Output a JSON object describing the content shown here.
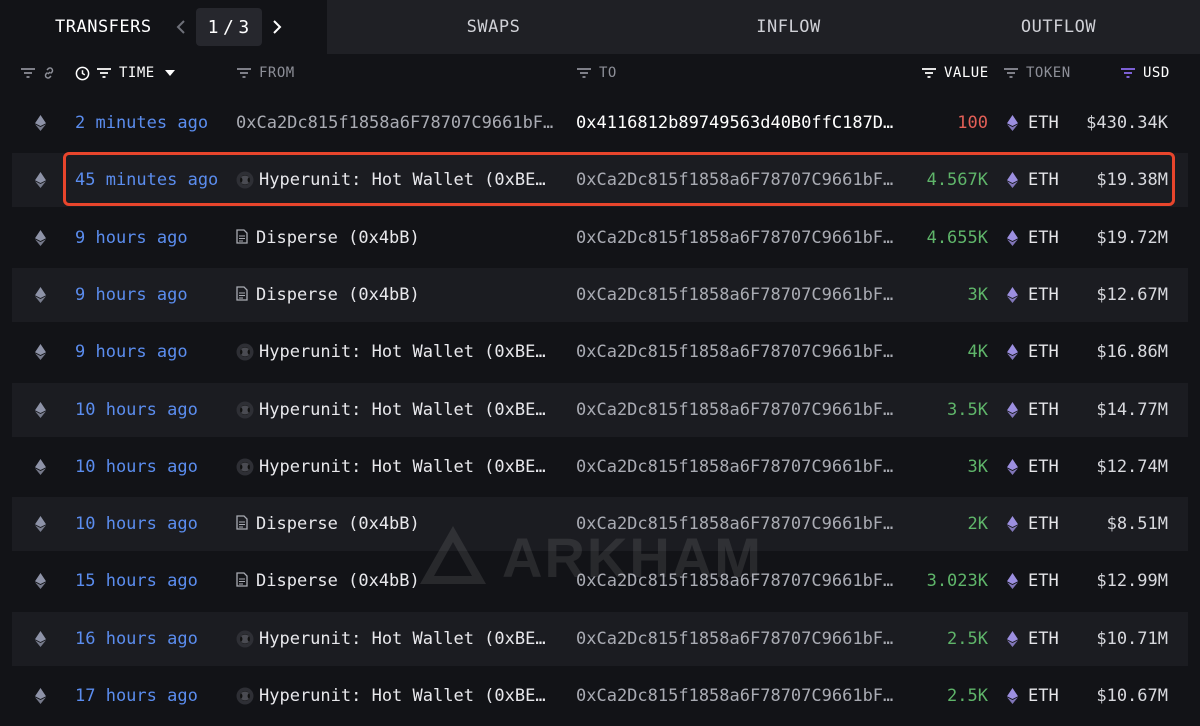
{
  "tabs": [
    {
      "label": "TRANSFERS",
      "active": true
    },
    {
      "label": "SWAPS",
      "active": false
    },
    {
      "label": "INFLOW",
      "active": false
    },
    {
      "label": "OUTFLOW",
      "active": false
    }
  ],
  "pagination": {
    "current": "1",
    "separator": "/",
    "total": "3"
  },
  "columns": {
    "time": "TIME",
    "from": "FROM",
    "to": "TO",
    "value": "VALUE",
    "token": "TOKEN",
    "usd": "USD"
  },
  "colors": {
    "time_link": "#5b8def",
    "value_positive": "#5fb56a",
    "value_negative": "#e25f57",
    "highlight": "#e8452c",
    "usd_filter_accent": "#8b6cf0"
  },
  "watermark": "ARKHAM",
  "rows": [
    {
      "time": "2 minutes ago",
      "from": "0xCa2Dc815f1858a6F78707C9661bF…",
      "from_icon": "none",
      "to": "0x4116812b89749563d40B0ffC187D…",
      "value": "100",
      "token": "ETH",
      "usd": "$430.34K"
    },
    {
      "time": "45 minutes ago",
      "from": "Hyperunit: Hot Wallet (0xBE…",
      "from_icon": "entity-logo-icon",
      "to": "0xCa2Dc815f1858a6F78707C9661bF…",
      "value": "4.567K",
      "token": "ETH",
      "usd": "$19.38M"
    },
    {
      "time": "9 hours ago",
      "from": "Disperse (0x4bB)",
      "from_icon": "contract-icon",
      "to": "0xCa2Dc815f1858a6F78707C9661bF…",
      "value": "4.655K",
      "token": "ETH",
      "usd": "$19.72M"
    },
    {
      "time": "9 hours ago",
      "from": "Disperse (0x4bB)",
      "from_icon": "contract-icon",
      "to": "0xCa2Dc815f1858a6F78707C9661bF…",
      "value": "3K",
      "token": "ETH",
      "usd": "$12.67M"
    },
    {
      "time": "9 hours ago",
      "from": "Hyperunit: Hot Wallet (0xBE…",
      "from_icon": "entity-logo-icon",
      "to": "0xCa2Dc815f1858a6F78707C9661bF…",
      "value": "4K",
      "token": "ETH",
      "usd": "$16.86M"
    },
    {
      "time": "10 hours ago",
      "from": "Hyperunit: Hot Wallet (0xBE…",
      "from_icon": "entity-logo-icon",
      "to": "0xCa2Dc815f1858a6F78707C9661bF…",
      "value": "3.5K",
      "token": "ETH",
      "usd": "$14.77M"
    },
    {
      "time": "10 hours ago",
      "from": "Hyperunit: Hot Wallet (0xBE…",
      "from_icon": "entity-logo-icon",
      "to": "0xCa2Dc815f1858a6F78707C9661bF…",
      "value": "3K",
      "token": "ETH",
      "usd": "$12.74M"
    },
    {
      "time": "10 hours ago",
      "from": "Disperse (0x4bB)",
      "from_icon": "contract-icon",
      "to": "0xCa2Dc815f1858a6F78707C9661bF…",
      "value": "2K",
      "token": "ETH",
      "usd": "$8.51M"
    },
    {
      "time": "15 hours ago",
      "from": "Disperse (0x4bB)",
      "from_icon": "contract-icon",
      "to": "0xCa2Dc815f1858a6F78707C9661bF…",
      "value": "3.023K",
      "token": "ETH",
      "usd": "$12.99M"
    },
    {
      "time": "16 hours ago",
      "from": "Hyperunit: Hot Wallet (0xBE…",
      "from_icon": "entity-logo-icon",
      "to": "0xCa2Dc815f1858a6F78707C9661bF…",
      "value": "2.5K",
      "token": "ETH",
      "usd": "$10.71M"
    },
    {
      "time": "17 hours ago",
      "from": "Hyperunit: Hot Wallet (0xBE…",
      "from_icon": "entity-logo-icon",
      "to": "0xCa2Dc815f1858a6F78707C9661bF…",
      "value": "2.5K",
      "token": "ETH",
      "usd": "$10.67M"
    }
  ]
}
